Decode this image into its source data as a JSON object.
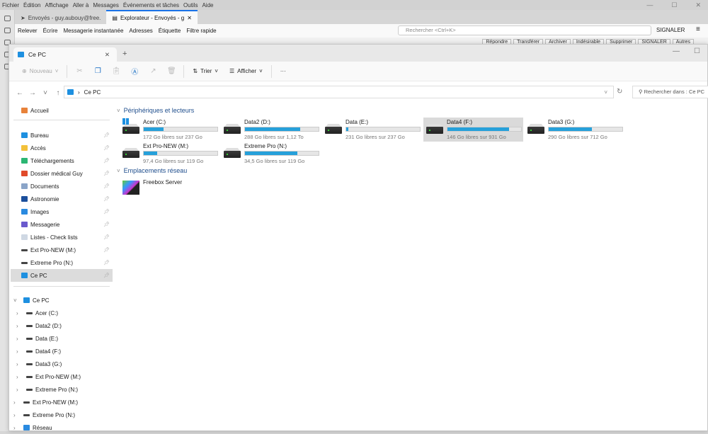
{
  "thunderbird": {
    "menu": [
      "Fichier",
      "Édition",
      "Affichage",
      "Aller à",
      "Messages",
      "Événements et tâches",
      "Outils",
      "Aide"
    ],
    "tabs": [
      {
        "label": "Envoyés - guy.aubouy@free."
      },
      {
        "label": "Explorateur - Envoyés - g"
      }
    ],
    "toolbar": [
      "Relever",
      "Écrire",
      "Messagerie instantanée",
      "Adresses",
      "Étiquette",
      "Filtre rapide"
    ],
    "search_placeholder": "Rechercher <Ctrl+K>",
    "signal": "SIGNALER",
    "message_buttons": [
      "Répondre",
      "Transférer",
      "Archiver",
      "Indésirable",
      "Supprimer",
      "SIGNALER",
      "Autres"
    ]
  },
  "explorer": {
    "tab_title": "Ce PC",
    "toolbar": {
      "new": "Nouveau",
      "sort": "Trier",
      "view": "Afficher",
      "more": "···"
    },
    "address": {
      "path": "Ce PC",
      "search_placeholder": "Rechercher dans : Ce PC"
    },
    "sidebar": {
      "home": "Accueil",
      "quick": [
        {
          "label": "Bureau",
          "icon": "desktop-icon",
          "color": "#1e90e0"
        },
        {
          "label": "Accès",
          "icon": "folder-icon",
          "color": "#f3c13a"
        },
        {
          "label": "Téléchargements",
          "icon": "download-icon",
          "color": "#2bb673"
        },
        {
          "label": "Dossier médical Guy",
          "icon": "x-icon",
          "color": "#e04a2a"
        },
        {
          "label": "Documents",
          "icon": "documents-icon",
          "color": "#8aa4c8"
        },
        {
          "label": "Astronomie",
          "icon": "astronomy-icon",
          "color": "#1c4f9c"
        },
        {
          "label": "Images",
          "icon": "images-icon",
          "color": "#2a8ae0"
        },
        {
          "label": "Messagerie",
          "icon": "messaging-icon",
          "color": "#6a5acd"
        },
        {
          "label": "Listes - Check lists",
          "icon": "file-icon",
          "color": "#cfd8e3"
        },
        {
          "label": "Ext Pro-NEW (M:)",
          "icon": "drive-icon"
        },
        {
          "label": "Extreme Pro (N:)",
          "icon": "drive-icon"
        },
        {
          "label": "Ce PC",
          "icon": "pc-icon",
          "color": "#1e90e0",
          "selected": true
        }
      ],
      "tree_root": "Ce PC",
      "tree": [
        "Acer (C:)",
        "Data2 (D:)",
        "Data (E:)",
        "Data4 (F:)",
        "Data3 (G:)",
        "Ext Pro-NEW (M:)",
        "Extreme Pro (N:)"
      ],
      "tail": [
        "Ext Pro-NEW (M:)",
        "Extreme Pro (N:)",
        "Réseau"
      ]
    },
    "groups": {
      "devices": "Périphériques et lecteurs",
      "network": "Emplacements réseau"
    },
    "drives": [
      {
        "name": "Acer (C:)",
        "info": "172 Go libres sur 237 Go",
        "used_fraction": 0.27,
        "windows": true
      },
      {
        "name": "Data2 (D:)",
        "info": "288 Go libres sur 1,12 To",
        "used_fraction": 0.75
      },
      {
        "name": "Data (E:)",
        "info": "231 Go libres sur 237 Go",
        "used_fraction": 0.03
      },
      {
        "name": "Data4 (F:)",
        "info": "146 Go libres sur 931 Go",
        "used_fraction": 0.84,
        "selected": true
      },
      {
        "name": "Data3 (G:)",
        "info": "290 Go libres sur 712 Go",
        "used_fraction": 0.59
      },
      {
        "name": "Ext Pro-NEW (M:)",
        "info": "97,4 Go libres sur 119 Go",
        "used_fraction": 0.18
      },
      {
        "name": "Extreme Pro (N:)",
        "info": "34,5 Go libres sur 119 Go",
        "used_fraction": 0.71
      }
    ],
    "network": [
      {
        "name": "Freebox Server"
      }
    ]
  }
}
